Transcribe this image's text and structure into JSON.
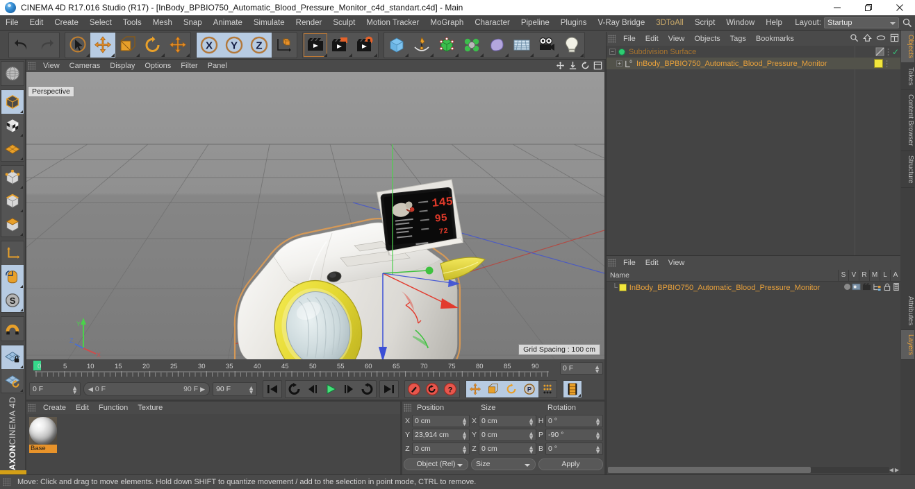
{
  "window": {
    "title": "CINEMA 4D R17.016 Studio (R17) - [InBody_BPBIO750_Automatic_Blood_Pressure_Monitor_c4d_standart.c4d] - Main",
    "app_icon": "c4d-logo-icon",
    "minimize": "minimize-icon",
    "maximize": "restore-icon",
    "close": "close-icon"
  },
  "menubar": {
    "items": [
      "File",
      "Edit",
      "Create",
      "Select",
      "Tools",
      "Mesh",
      "Snap",
      "Animate",
      "Simulate",
      "Render",
      "Sculpt",
      "Motion Tracker",
      "MoGraph",
      "Character",
      "Pipeline",
      "Plugins",
      "V-Ray Bridge",
      "3DToAll",
      "Script",
      "Window",
      "Help"
    ],
    "layout_label": "Layout:",
    "layout_value": "Startup",
    "search_icon": "search-icon"
  },
  "toolbar": {
    "groups": [
      {
        "name": "history",
        "buttons": [
          {
            "name": "undo-button",
            "icon": "undo-arrow-icon",
            "state": "enabled"
          },
          {
            "name": "redo-button",
            "icon": "redo-arrow-icon",
            "state": "disabled"
          }
        ]
      },
      {
        "name": "tools",
        "buttons": [
          {
            "name": "live-selection-tool",
            "icon": "cursor-circle-icon",
            "state": "enabled"
          },
          {
            "name": "move-tool",
            "icon": "move-arrows-icon",
            "state": "selected"
          },
          {
            "name": "scale-tool",
            "icon": "scale-box-icon",
            "state": "enabled"
          },
          {
            "name": "rotate-tool",
            "icon": "rotate-circle-icon",
            "state": "enabled"
          },
          {
            "name": "transform-tool",
            "icon": "move-arrows-icon",
            "state": "enabled"
          }
        ]
      },
      {
        "name": "axis-locks",
        "buttons": [
          {
            "name": "x-axis-lock",
            "icon": "x-axis-icon",
            "state": "selected"
          },
          {
            "name": "y-axis-lock",
            "icon": "y-axis-icon",
            "state": "selected"
          },
          {
            "name": "z-axis-lock",
            "icon": "z-axis-icon",
            "state": "selected"
          },
          {
            "name": "world-object-coordinates",
            "icon": "world-axis-cube-icon",
            "state": "enabled"
          }
        ]
      },
      {
        "name": "render",
        "buttons": [
          {
            "name": "render-view-button",
            "icon": "clapperboard-icon",
            "state": "framed"
          },
          {
            "name": "render-to-picture-viewer-button",
            "icon": "clapperboard-picture-icon",
            "state": "enabled"
          },
          {
            "name": "render-settings-button",
            "icon": "clapperboard-gear-icon",
            "state": "enabled"
          }
        ]
      },
      {
        "name": "create",
        "buttons": [
          {
            "name": "add-cube-button",
            "icon": "cube-icon",
            "state": "enabled"
          },
          {
            "name": "add-spline-button",
            "icon": "pen-spline-icon",
            "state": "enabled"
          },
          {
            "name": "add-generator-button",
            "icon": "green-cube-icon",
            "state": "enabled"
          },
          {
            "name": "add-mograph-button",
            "icon": "cloner-icon",
            "state": "enabled"
          },
          {
            "name": "add-deformer-button",
            "icon": "bend-deformer-icon",
            "state": "enabled"
          },
          {
            "name": "add-scene-button",
            "icon": "floor-grid-icon",
            "state": "enabled"
          },
          {
            "name": "add-camera-button",
            "icon": "camera-icon",
            "state": "enabled"
          },
          {
            "name": "add-light-button",
            "icon": "lightbulb-icon",
            "state": "enabled"
          }
        ]
      }
    ]
  },
  "left_toolbar": {
    "groups": [
      {
        "buttons": [
          {
            "name": "make-editable-button",
            "icon": "sphere-wireframe-icon",
            "state": "enabled"
          }
        ]
      },
      {
        "buttons": [
          {
            "name": "model-mode-button",
            "icon": "model-cube-icon",
            "state": "selected"
          },
          {
            "name": "texture-mode-button",
            "icon": "texture-cube-icon",
            "state": "enabled"
          },
          {
            "name": "workplane-mode-button",
            "icon": "workplane-grid-icon",
            "state": "enabled"
          }
        ]
      },
      {
        "buttons": [
          {
            "name": "point-mode-button",
            "icon": "points-cube-icon",
            "state": "enabled"
          },
          {
            "name": "edge-mode-button",
            "icon": "edges-cube-icon",
            "state": "enabled"
          },
          {
            "name": "polygon-mode-button",
            "icon": "polygon-cube-icon",
            "state": "enabled"
          }
        ]
      },
      {
        "buttons": [
          {
            "name": "object-axis-mode-button",
            "icon": "axis-l-icon",
            "state": "enabled"
          },
          {
            "name": "enable-axis-modification-button",
            "icon": "mouse-axis-icon",
            "state": "selected"
          },
          {
            "name": "snap-settings-button",
            "icon": "s-circle-icon",
            "state": "selected"
          }
        ]
      },
      {
        "buttons": [
          {
            "name": "magnet-tool-button",
            "icon": "magnet-icon",
            "state": "enabled"
          }
        ]
      },
      {
        "buttons": [
          {
            "name": "lock-workplane-button",
            "icon": "workplane-lock-icon",
            "state": "selected"
          },
          {
            "name": "planar-workplane-button",
            "icon": "workplane-rotate-icon",
            "state": "enabled"
          }
        ]
      }
    ],
    "brand_bold": "MAXON",
    "brand_rest": "CINEMA 4D"
  },
  "viewport": {
    "menus": [
      "View",
      "Cameras",
      "Display",
      "Options",
      "Filter",
      "Panel"
    ],
    "corner_icons": [
      "pan-icon",
      "dolly-icon",
      "orbit-icon",
      "maximize-view-icon"
    ],
    "label": "Perspective",
    "grid_spacing": "Grid Spacing : 100 cm",
    "axis_gizmo": {
      "x_color": "#d14b4b",
      "y_color": "#4bd14b",
      "z_color": "#4b6fd1"
    },
    "gizmo": {
      "x_color": "#e23b2e",
      "y_color": "#3fc23f",
      "z_color": "#3b4fd6"
    },
    "model": {
      "name": "InBody BPBIO750 Automatic Blood Pressure Monitor",
      "body_color": "#f2f1ef",
      "accent_color": "#e8dd3a",
      "screen_color": "#0b0b0b",
      "readout_color": "#e03a2a",
      "outline_color": "#d9a05b",
      "screen_values": [
        "145",
        "95",
        "72"
      ]
    }
  },
  "timeline": {
    "ticks": [
      0,
      5,
      10,
      15,
      20,
      25,
      30,
      35,
      40,
      45,
      50,
      55,
      60,
      65,
      70,
      75,
      80,
      85,
      90
    ],
    "playhead_frame": 0,
    "end_field": "0 F"
  },
  "transport": {
    "current_frame": "0 F",
    "range_start": "0 F",
    "range_end": "90 F",
    "max_frame": "90 F",
    "buttons": [
      {
        "name": "go-to-start-button",
        "icon": "skip-start-icon"
      },
      {
        "name": "play-reverse-loop-button",
        "icon": "loop-reverse-icon"
      },
      {
        "name": "step-back-button",
        "icon": "step-back-icon"
      },
      {
        "name": "play-button",
        "icon": "play-icon"
      },
      {
        "name": "step-forward-button",
        "icon": "step-forward-icon"
      },
      {
        "name": "play-forward-loop-button",
        "icon": "loop-forward-icon"
      },
      {
        "name": "go-to-end-button",
        "icon": "skip-end-icon"
      }
    ],
    "record_buttons": [
      {
        "name": "record-active-objects-button",
        "icon": "record-key-icon"
      },
      {
        "name": "autokeying-button",
        "icon": "autokey-icon"
      },
      {
        "name": "keyframe-selection-button",
        "icon": "question-key-icon"
      }
    ],
    "key_filters": [
      {
        "name": "position-key-button",
        "icon": "move-arrows-icon",
        "state": "selected"
      },
      {
        "name": "scale-key-button",
        "icon": "scale-box-icon",
        "state": "selected"
      },
      {
        "name": "rotation-key-button",
        "icon": "rotate-circle-icon",
        "state": "selected"
      },
      {
        "name": "parameter-key-button",
        "icon": "p-circle-icon",
        "state": "selected"
      },
      {
        "name": "point-level-animation-button",
        "icon": "pla-dots-icon",
        "state": "enabled"
      }
    ],
    "timeline_toggle": {
      "name": "open-timeline-button",
      "icon": "timeline-icon",
      "state": "selected"
    }
  },
  "material_manager": {
    "menus": [
      "Create",
      "Edit",
      "Function",
      "Texture"
    ],
    "materials": [
      {
        "name": "Base",
        "selected": true
      }
    ]
  },
  "coordinates": {
    "headers": [
      "Position",
      "Size",
      "Rotation"
    ],
    "position": {
      "labels": [
        "X",
        "Y",
        "Z"
      ],
      "values": [
        "0 cm",
        "23,914 cm",
        "0 cm"
      ]
    },
    "size": {
      "labels": [
        "X",
        "Y",
        "Z"
      ],
      "values": [
        "0 cm",
        "0 cm",
        "0 cm"
      ]
    },
    "rotation": {
      "labels": [
        "H",
        "P",
        "B"
      ],
      "values": [
        "0 °",
        "-90 °",
        "0 °"
      ]
    },
    "mode_left": "Object (Rel)",
    "mode_mid": "Size",
    "apply_label": "Apply"
  },
  "object_manager": {
    "menus": [
      "File",
      "Edit",
      "View",
      "Objects",
      "Tags",
      "Bookmarks"
    ],
    "right_icons": [
      "search-icon",
      "home-icon",
      "eye-icon",
      "layout-icon"
    ],
    "rows": [
      {
        "name": "Subdivision Surface",
        "indent": 0,
        "icon": "subdivision-surface-icon",
        "dimmed": true,
        "expander": "-",
        "tag_icon": "hidden-tag-icon",
        "check": "✓"
      },
      {
        "name": "InBody_BPBIO750_Automatic_Blood_Pressure_Monitor",
        "indent": 1,
        "icon": "polygon-object-icon",
        "dimmed": false,
        "expander": "+",
        "tag_icon": "yellow-material-tag-icon",
        "selected": true
      }
    ]
  },
  "layer_manager": {
    "menus": [
      "File",
      "Edit",
      "View"
    ],
    "name_header": "Name",
    "columns": [
      "S",
      "V",
      "R",
      "M",
      "L",
      "A"
    ],
    "rows": [
      {
        "name": "InBody_BPBIO750_Automatic_Blood_Pressure_Monitor",
        "swatch": "#f2e63c",
        "icons": [
          "solo-dot-icon",
          "visible-icon",
          "render-icon",
          "manager-icon",
          "lock-icon",
          "animation-icon"
        ]
      }
    ]
  },
  "vertical_tabs": {
    "top": [
      {
        "label": "Objects",
        "active": true
      },
      {
        "label": "Takes",
        "active": false
      },
      {
        "label": "Content Browser",
        "active": false
      },
      {
        "label": "Structure",
        "active": false
      }
    ],
    "bottom": [
      {
        "label": "Attributes",
        "active": false
      },
      {
        "label": "Layers",
        "active": true
      }
    ]
  },
  "statusbar": {
    "text": "Move: Click and drag to move elements. Hold down SHIFT to quantize movement / add to the selection in point mode, CTRL to remove."
  }
}
